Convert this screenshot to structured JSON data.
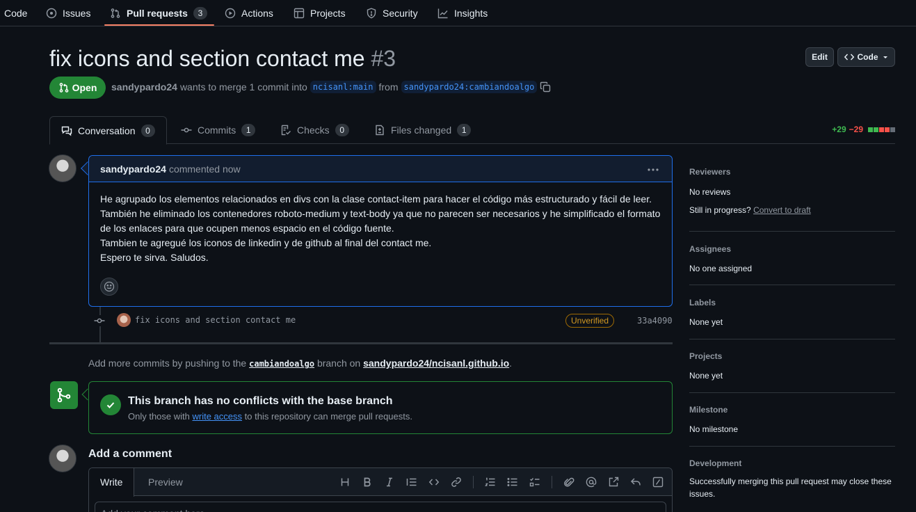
{
  "nav": {
    "code": "Code",
    "issues": "Issues",
    "pull_requests": "Pull requests",
    "pull_requests_count": "3",
    "actions": "Actions",
    "projects": "Projects",
    "security": "Security",
    "insights": "Insights"
  },
  "pr": {
    "title": "fix icons and section contact me",
    "number": "#3",
    "edit_label": "Edit",
    "code_label": "Code",
    "state": "Open",
    "author": "sandypardo24",
    "merge_text": "wants to merge 1 commit into",
    "base_branch": "ncisanl:main",
    "from_text": "from",
    "head_branch": "sandypardo24:cambiandoalgo"
  },
  "tabs": {
    "conversation": "Conversation",
    "conversation_count": "0",
    "commits": "Commits",
    "commits_count": "1",
    "checks": "Checks",
    "checks_count": "0",
    "files": "Files changed",
    "files_count": "1",
    "additions": "+29",
    "deletions": "−29"
  },
  "comment": {
    "author": "sandypardo24",
    "action": "commented now",
    "body_line1": "He agrupado los elementos relacionados en divs con la clase contact-item para hacer el código más estructurado y fácil de leer. También he eliminado los contenedores roboto-medium y text-body ya que no parecen ser necesarios y he simplificado el formato de los enlaces para que ocupen menos espacio en el código fuente.",
    "body_line2": "Tambien te agregué los iconos de linkedin y de github al final del contact me.",
    "body_line3": "Espero te sirva. Saludos."
  },
  "commit": {
    "message": "fix icons and section contact me",
    "verification": "Unverified",
    "sha": "33a4090"
  },
  "push_hint": {
    "prefix": "Add more commits by pushing to the",
    "branch": "cambiandoalgo",
    "middle": "branch on",
    "repo": "sandypardo24/ncisanl.github.io",
    "suffix": "."
  },
  "merge": {
    "title": "This branch has no conflicts with the base branch",
    "sub_prefix": "Only those with",
    "sub_link": "write access",
    "sub_suffix": "to this repository can merge pull requests."
  },
  "add_comment": {
    "title": "Add a comment",
    "write_tab": "Write",
    "preview_tab": "Preview",
    "placeholder": "Add your comment here..."
  },
  "sidebar": {
    "reviewers_head": "Reviewers",
    "reviewers_val": "No reviews",
    "in_progress": "Still in progress?",
    "convert_draft": "Convert to draft",
    "assignees_head": "Assignees",
    "assignees_val": "No one assigned",
    "labels_head": "Labels",
    "labels_val": "None yet",
    "projects_head": "Projects",
    "projects_val": "None yet",
    "milestone_head": "Milestone",
    "milestone_val": "No milestone",
    "development_head": "Development",
    "development_val": "Successfully merging this pull request may close these issues."
  },
  "colors": {
    "accent": "#1f6feb",
    "open_green": "#238636",
    "underline": "#f78166",
    "background": "#0d1117"
  }
}
